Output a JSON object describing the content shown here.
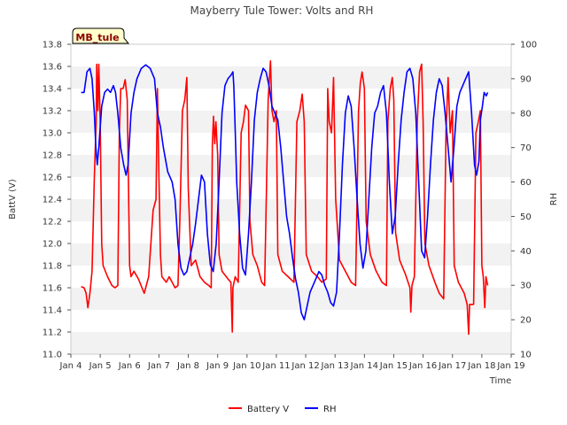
{
  "chart_data": {
    "type": "line",
    "title": "Mayberry Tule Tower: Volts and RH",
    "station_badge": "MB_tule",
    "xlabel": "Time",
    "ylabel_left": "BattV (V)",
    "ylabel_right": "RH",
    "x_ticks": [
      "Jan 4",
      "Jan 5",
      "Jan 6",
      "Jan 7",
      "Jan 8",
      "Jan 9",
      "Jan 10",
      "Jan 11",
      "Jan 12",
      "Jan 13",
      "Jan 14",
      "Jan 15",
      "Jan 16",
      "Jan 17",
      "Jan 18",
      "Jan 19"
    ],
    "xlim_days": [
      4,
      19
    ],
    "ylim_left": [
      11.0,
      13.8
    ],
    "y_ticks_left": [
      "11.0",
      "11.2",
      "11.4",
      "11.6",
      "11.8",
      "12.0",
      "12.2",
      "12.4",
      "12.6",
      "12.8",
      "13.0",
      "13.2",
      "13.4",
      "13.6",
      "13.8"
    ],
    "ylim_right": [
      10,
      100
    ],
    "y_ticks_right": [
      "10",
      "20",
      "30",
      "40",
      "50",
      "60",
      "70",
      "80",
      "90",
      "100"
    ],
    "grid": "horizontal bands",
    "legend_position": "bottom-center",
    "colors": {
      "battery": "#ff0000",
      "rh": "#0000ff",
      "band": "#f2f2f2",
      "badge_bg": "#ffffcc"
    },
    "series": [
      {
        "name": "Battery V",
        "axis": "left",
        "points": [
          [
            4.35,
            11.61
          ],
          [
            4.45,
            11.6
          ],
          [
            4.52,
            11.55
          ],
          [
            4.58,
            11.42
          ],
          [
            4.65,
            11.55
          ],
          [
            4.72,
            11.75
          ],
          [
            4.8,
            12.6
          ],
          [
            4.86,
            13.1
          ],
          [
            4.88,
            13.62
          ],
          [
            4.92,
            13.2
          ],
          [
            4.95,
            13.62
          ],
          [
            5.0,
            13.1
          ],
          [
            5.05,
            12.0
          ],
          [
            5.1,
            11.8
          ],
          [
            5.25,
            11.7
          ],
          [
            5.4,
            11.62
          ],
          [
            5.5,
            11.6
          ],
          [
            5.6,
            11.62
          ],
          [
            5.65,
            13.0
          ],
          [
            5.7,
            13.4
          ],
          [
            5.78,
            13.4
          ],
          [
            5.85,
            13.48
          ],
          [
            5.92,
            13.3
          ],
          [
            5.96,
            12.6
          ],
          [
            6.0,
            11.8
          ],
          [
            6.05,
            11.7
          ],
          [
            6.15,
            11.75
          ],
          [
            6.3,
            11.68
          ],
          [
            6.5,
            11.55
          ],
          [
            6.65,
            11.7
          ],
          [
            6.8,
            12.3
          ],
          [
            6.9,
            12.4
          ],
          [
            6.95,
            13.4
          ],
          [
            7.0,
            12.6
          ],
          [
            7.05,
            11.9
          ],
          [
            7.1,
            11.7
          ],
          [
            7.25,
            11.65
          ],
          [
            7.35,
            11.7
          ],
          [
            7.55,
            11.6
          ],
          [
            7.65,
            11.62
          ],
          [
            7.72,
            12.3
          ],
          [
            7.8,
            13.2
          ],
          [
            7.88,
            13.3
          ],
          [
            7.95,
            13.5
          ],
          [
            8.0,
            12.5
          ],
          [
            8.1,
            11.8
          ],
          [
            8.25,
            11.85
          ],
          [
            8.4,
            11.7
          ],
          [
            8.55,
            11.65
          ],
          [
            8.7,
            11.62
          ],
          [
            8.78,
            11.6
          ],
          [
            8.82,
            12.9
          ],
          [
            8.86,
            13.15
          ],
          [
            8.9,
            12.9
          ],
          [
            8.94,
            13.1
          ],
          [
            9.0,
            12.8
          ],
          [
            9.05,
            11.9
          ],
          [
            9.15,
            11.75
          ],
          [
            9.35,
            11.68
          ],
          [
            9.45,
            11.65
          ],
          [
            9.5,
            11.2
          ],
          [
            9.52,
            11.6
          ],
          [
            9.6,
            11.7
          ],
          [
            9.7,
            11.65
          ],
          [
            9.8,
            13.0
          ],
          [
            9.88,
            13.1
          ],
          [
            9.95,
            13.25
          ],
          [
            10.05,
            13.2
          ],
          [
            10.1,
            12.2
          ],
          [
            10.2,
            11.9
          ],
          [
            10.35,
            11.8
          ],
          [
            10.5,
            11.65
          ],
          [
            10.6,
            11.62
          ],
          [
            10.72,
            13.3
          ],
          [
            10.8,
            13.65
          ],
          [
            10.85,
            13.2
          ],
          [
            10.92,
            13.1
          ],
          [
            11.0,
            13.2
          ],
          [
            11.05,
            11.9
          ],
          [
            11.2,
            11.75
          ],
          [
            11.4,
            11.7
          ],
          [
            11.6,
            11.65
          ],
          [
            11.7,
            13.1
          ],
          [
            11.8,
            13.2
          ],
          [
            11.88,
            13.35
          ],
          [
            11.95,
            13.1
          ],
          [
            12.02,
            11.9
          ],
          [
            12.2,
            11.75
          ],
          [
            12.4,
            11.7
          ],
          [
            12.55,
            11.65
          ],
          [
            12.7,
            11.68
          ],
          [
            12.75,
            13.4
          ],
          [
            12.8,
            13.1
          ],
          [
            12.88,
            13.0
          ],
          [
            12.95,
            13.5
          ],
          [
            13.02,
            12.4
          ],
          [
            13.15,
            11.85
          ],
          [
            13.35,
            11.75
          ],
          [
            13.55,
            11.65
          ],
          [
            13.7,
            11.62
          ],
          [
            13.8,
            13.2
          ],
          [
            13.86,
            13.45
          ],
          [
            13.92,
            13.55
          ],
          [
            14.0,
            13.4
          ],
          [
            14.06,
            12.2
          ],
          [
            14.2,
            11.9
          ],
          [
            14.4,
            11.75
          ],
          [
            14.6,
            11.65
          ],
          [
            14.75,
            11.62
          ],
          [
            14.8,
            13.1
          ],
          [
            14.88,
            13.4
          ],
          [
            14.95,
            13.5
          ],
          [
            15.0,
            13.3
          ],
          [
            15.06,
            12.1
          ],
          [
            15.2,
            11.85
          ],
          [
            15.4,
            11.72
          ],
          [
            15.55,
            11.6
          ],
          [
            15.58,
            11.38
          ],
          [
            15.62,
            11.62
          ],
          [
            15.7,
            11.7
          ],
          [
            15.8,
            13.1
          ],
          [
            15.88,
            13.55
          ],
          [
            15.95,
            13.62
          ],
          [
            16.0,
            13.1
          ],
          [
            16.06,
            12.0
          ],
          [
            16.2,
            11.8
          ],
          [
            16.4,
            11.65
          ],
          [
            16.55,
            11.55
          ],
          [
            16.7,
            11.5
          ],
          [
            16.78,
            13.0
          ],
          [
            16.85,
            13.5
          ],
          [
            16.92,
            13.0
          ],
          [
            17.0,
            13.2
          ],
          [
            17.06,
            11.8
          ],
          [
            17.2,
            11.65
          ],
          [
            17.4,
            11.55
          ],
          [
            17.5,
            11.45
          ],
          [
            17.55,
            11.18
          ],
          [
            17.58,
            11.45
          ],
          [
            17.72,
            11.45
          ],
          [
            17.8,
            13.0
          ],
          [
            17.88,
            13.1
          ],
          [
            17.95,
            13.2
          ],
          [
            18.0,
            11.8
          ],
          [
            18.05,
            11.7
          ],
          [
            18.1,
            11.42
          ],
          [
            18.14,
            11.7
          ],
          [
            18.2,
            11.62
          ]
        ]
      },
      {
        "name": "RH",
        "axis": "right",
        "points": [
          [
            4.35,
            86
          ],
          [
            4.45,
            86
          ],
          [
            4.55,
            92
          ],
          [
            4.65,
            93
          ],
          [
            4.72,
            90
          ],
          [
            4.8,
            80
          ],
          [
            4.85,
            70
          ],
          [
            4.9,
            65
          ],
          [
            4.95,
            70
          ],
          [
            5.05,
            82
          ],
          [
            5.15,
            86
          ],
          [
            5.25,
            87
          ],
          [
            5.35,
            86
          ],
          [
            5.45,
            88
          ],
          [
            5.52,
            86
          ],
          [
            5.6,
            80
          ],
          [
            5.7,
            70
          ],
          [
            5.8,
            65
          ],
          [
            5.88,
            62
          ],
          [
            5.95,
            65
          ],
          [
            6.05,
            80
          ],
          [
            6.15,
            86
          ],
          [
            6.25,
            90
          ],
          [
            6.4,
            93
          ],
          [
            6.55,
            94
          ],
          [
            6.7,
            93
          ],
          [
            6.85,
            90
          ],
          [
            6.95,
            80
          ],
          [
            7.05,
            76
          ],
          [
            7.15,
            70
          ],
          [
            7.3,
            63
          ],
          [
            7.45,
            60
          ],
          [
            7.55,
            55
          ],
          [
            7.65,
            42
          ],
          [
            7.75,
            35
          ],
          [
            7.85,
            33
          ],
          [
            7.95,
            34
          ],
          [
            8.05,
            38
          ],
          [
            8.15,
            42
          ],
          [
            8.25,
            48
          ],
          [
            8.35,
            55
          ],
          [
            8.45,
            62
          ],
          [
            8.55,
            60
          ],
          [
            8.65,
            45
          ],
          [
            8.75,
            36
          ],
          [
            8.85,
            34
          ],
          [
            8.95,
            42
          ],
          [
            9.05,
            60
          ],
          [
            9.15,
            80
          ],
          [
            9.25,
            88
          ],
          [
            9.35,
            90
          ],
          [
            9.45,
            91
          ],
          [
            9.52,
            92
          ],
          [
            9.55,
            88
          ],
          [
            9.6,
            75
          ],
          [
            9.65,
            60
          ],
          [
            9.75,
            45
          ],
          [
            9.85,
            35
          ],
          [
            9.95,
            33
          ],
          [
            10.05,
            45
          ],
          [
            10.15,
            60
          ],
          [
            10.25,
            78
          ],
          [
            10.35,
            86
          ],
          [
            10.45,
            90
          ],
          [
            10.55,
            93
          ],
          [
            10.65,
            92
          ],
          [
            10.75,
            88
          ],
          [
            10.85,
            82
          ],
          [
            10.95,
            80
          ],
          [
            11.05,
            78
          ],
          [
            11.15,
            70
          ],
          [
            11.25,
            60
          ],
          [
            11.35,
            50
          ],
          [
            11.45,
            45
          ],
          [
            11.55,
            38
          ],
          [
            11.65,
            32
          ],
          [
            11.75,
            28
          ],
          [
            11.85,
            22
          ],
          [
            11.95,
            20
          ],
          [
            12.05,
            24
          ],
          [
            12.15,
            28
          ],
          [
            12.25,
            30
          ],
          [
            12.35,
            32
          ],
          [
            12.45,
            34
          ],
          [
            12.55,
            33
          ],
          [
            12.65,
            30
          ],
          [
            12.75,
            28
          ],
          [
            12.85,
            25
          ],
          [
            12.95,
            24
          ],
          [
            13.05,
            28
          ],
          [
            13.15,
            45
          ],
          [
            13.25,
            65
          ],
          [
            13.35,
            80
          ],
          [
            13.45,
            85
          ],
          [
            13.55,
            82
          ],
          [
            13.65,
            70
          ],
          [
            13.75,
            55
          ],
          [
            13.85,
            42
          ],
          [
            13.95,
            35
          ],
          [
            14.05,
            40
          ],
          [
            14.15,
            55
          ],
          [
            14.25,
            70
          ],
          [
            14.35,
            80
          ],
          [
            14.45,
            82
          ],
          [
            14.55,
            86
          ],
          [
            14.65,
            88
          ],
          [
            14.75,
            80
          ],
          [
            14.85,
            60
          ],
          [
            14.95,
            45
          ],
          [
            15.05,
            50
          ],
          [
            15.15,
            65
          ],
          [
            15.25,
            78
          ],
          [
            15.35,
            86
          ],
          [
            15.45,
            92
          ],
          [
            15.55,
            93
          ],
          [
            15.65,
            90
          ],
          [
            15.75,
            80
          ],
          [
            15.85,
            60
          ],
          [
            15.95,
            40
          ],
          [
            16.05,
            38
          ],
          [
            16.15,
            50
          ],
          [
            16.25,
            65
          ],
          [
            16.35,
            78
          ],
          [
            16.45,
            86
          ],
          [
            16.55,
            90
          ],
          [
            16.65,
            88
          ],
          [
            16.75,
            80
          ],
          [
            16.85,
            70
          ],
          [
            16.95,
            60
          ],
          [
            17.05,
            70
          ],
          [
            17.15,
            82
          ],
          [
            17.25,
            86
          ],
          [
            17.35,
            88
          ],
          [
            17.45,
            90
          ],
          [
            17.55,
            92
          ],
          [
            17.65,
            80
          ],
          [
            17.75,
            65
          ],
          [
            17.82,
            62
          ],
          [
            17.9,
            66
          ],
          [
            17.95,
            78
          ],
          [
            18.02,
            82
          ],
          [
            18.08,
            86
          ],
          [
            18.15,
            85
          ],
          [
            18.2,
            86
          ]
        ]
      }
    ]
  }
}
